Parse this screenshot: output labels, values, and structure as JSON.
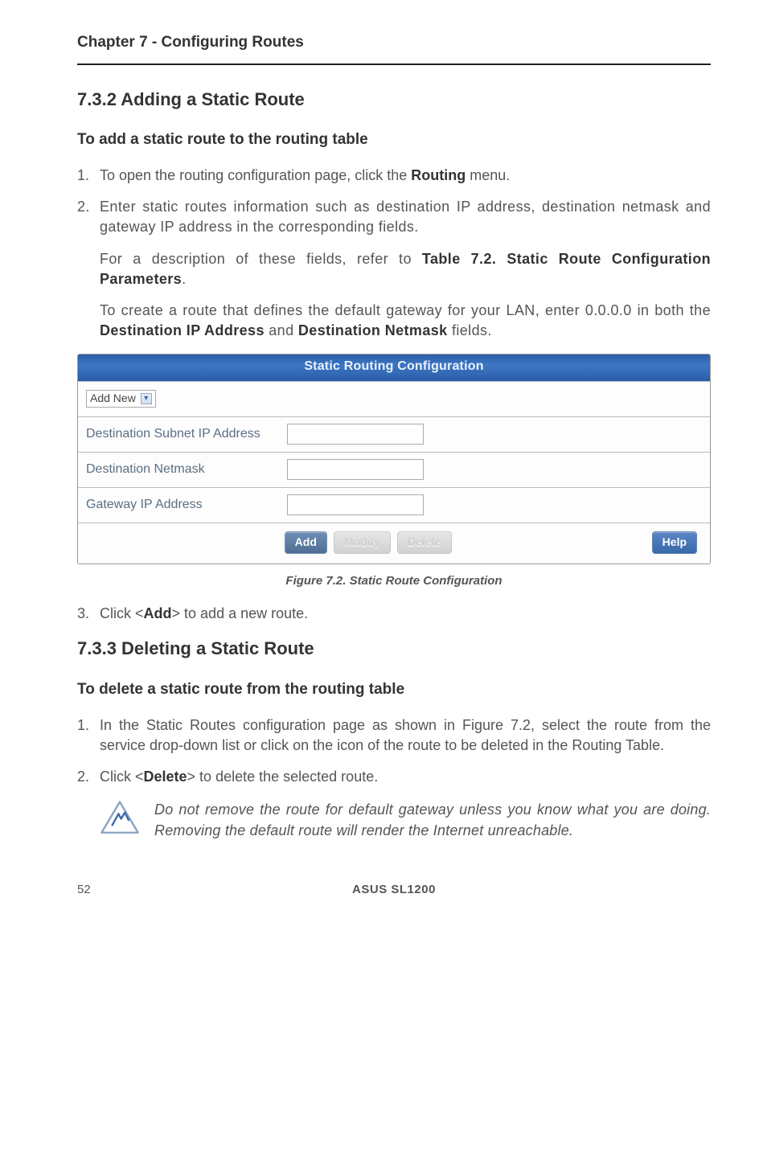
{
  "running_head": "Chapter 7 - Configuring Routes",
  "s732": {
    "title": "7.3.2 Adding a Static Route",
    "subhead": "To add a static route to the routing table",
    "step1_a": "To open the routing configuration page, click the ",
    "step1_b": "Routing",
    "step1_c": " menu.",
    "step2_a": "Enter static routes information such as destination IP address, destination netmask and gateway IP address in the corresponding fields.",
    "step2_b1": "For a description of these fields, refer to ",
    "step2_b2": "Table 7.2. Static Route Configuration Parameters",
    "step2_b3": ".",
    "step2_c1": "To create a route that defines the default gateway for your LAN, enter 0.0.0.0 in both the ",
    "step2_c2": "Destination IP Address",
    "step2_c3": " and ",
    "step2_c4": "Destination Netmask",
    "step2_c5": " fields."
  },
  "panel": {
    "title": "Static Routing Configuration",
    "select_label": "Add New",
    "row1": "Destination Subnet IP Address",
    "row2": "Destination Netmask",
    "row3": "Gateway IP Address",
    "btn_add": "Add",
    "btn_modify": "Modify",
    "btn_delete": "Delete",
    "btn_help": "Help"
  },
  "figure_cap": "Figure 7.2. Static Route Configuration",
  "step3_a": "Click <",
  "step3_b": "Add",
  "step3_c": "> to add a new route.",
  "s733": {
    "title": "7.3.3 Deleting a Static Route",
    "subhead": "To delete a static route from the routing table",
    "step1": "In the Static Routes configuration page as shown in Figure 7.2, select the route from the service drop-down list or click on the icon of the route to be deleted in the Routing Table.",
    "step2_a": "Click <",
    "step2_b": "Delete",
    "step2_c": "> to delete the selected route."
  },
  "note": "Do not remove the route for default gateway unless you know what you are doing. Removing the default route will render the Internet unreachable.",
  "footer": {
    "page": "52",
    "product": "ASUS SL1200"
  }
}
